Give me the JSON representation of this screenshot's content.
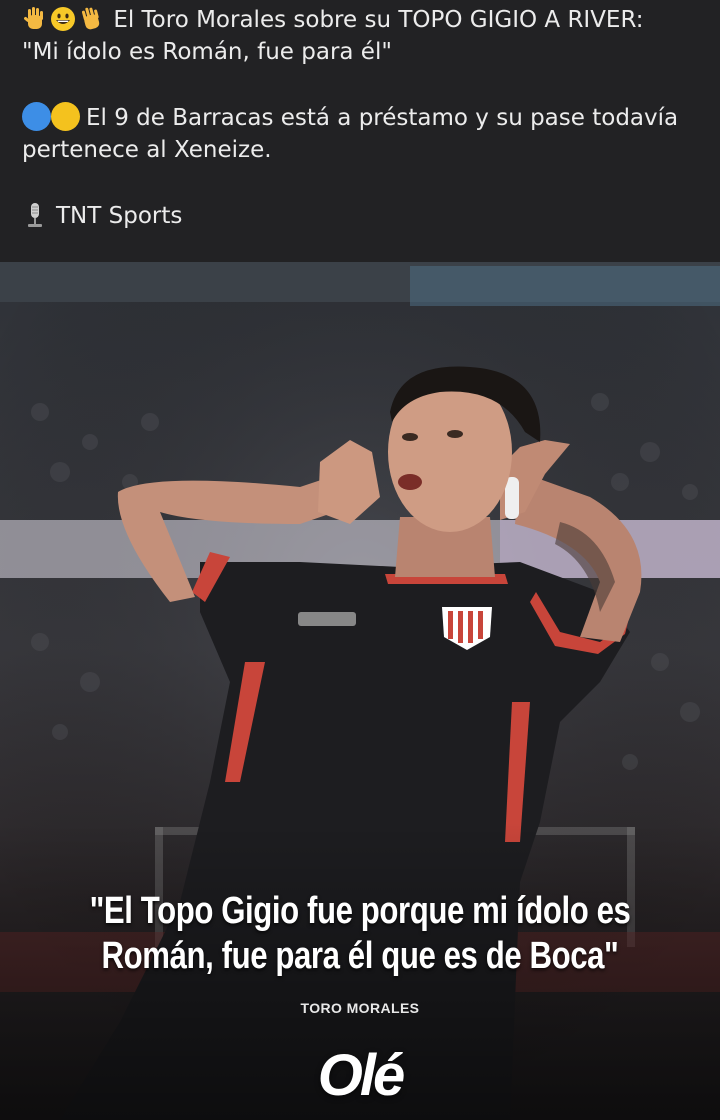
{
  "post": {
    "line1": "El Toro Morales sobre su TOPO GIGIO A RIVER:",
    "line2": "\"Mi ídolo es Román, fue para él\"",
    "line3": "El 9 de Barracas está a préstamo y su pase todavía",
    "line4": "pertenece al Xeneize.",
    "source": "TNT Sports",
    "icons": [
      "raised-hand-icon",
      "grinning-face-icon",
      "waving-hand-icon",
      "blue-circle-icon",
      "yellow-circle-icon",
      "microphone-icon"
    ]
  },
  "image": {
    "quote_line1": "\"El Topo Gigio fue porque mi ídolo es",
    "quote_line2": "Román, fue para él que es de Boca\"",
    "credit": "TORO MORALES",
    "brand": "Olé"
  },
  "colors": {
    "post_bg": "#222224",
    "blue_circle": "#3d8ee6",
    "yellow_circle": "#f4c21e",
    "jersey": "#1d1d20",
    "jersey_trim": "#c8453a"
  }
}
